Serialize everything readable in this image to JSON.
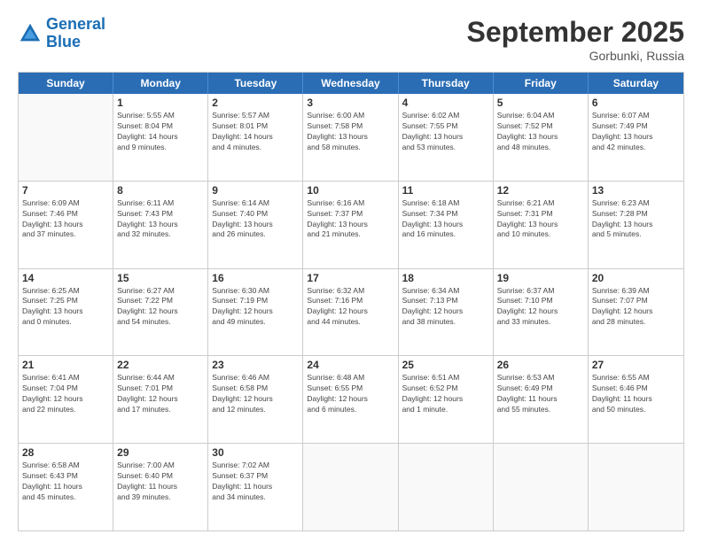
{
  "logo": {
    "line1": "General",
    "line2": "Blue"
  },
  "title": "September 2025",
  "location": "Gorbunki, Russia",
  "days_header": [
    "Sunday",
    "Monday",
    "Tuesday",
    "Wednesday",
    "Thursday",
    "Friday",
    "Saturday"
  ],
  "weeks": [
    [
      {
        "day": "",
        "info": ""
      },
      {
        "day": "1",
        "info": "Sunrise: 5:55 AM\nSunset: 8:04 PM\nDaylight: 14 hours\nand 9 minutes."
      },
      {
        "day": "2",
        "info": "Sunrise: 5:57 AM\nSunset: 8:01 PM\nDaylight: 14 hours\nand 4 minutes."
      },
      {
        "day": "3",
        "info": "Sunrise: 6:00 AM\nSunset: 7:58 PM\nDaylight: 13 hours\nand 58 minutes."
      },
      {
        "day": "4",
        "info": "Sunrise: 6:02 AM\nSunset: 7:55 PM\nDaylight: 13 hours\nand 53 minutes."
      },
      {
        "day": "5",
        "info": "Sunrise: 6:04 AM\nSunset: 7:52 PM\nDaylight: 13 hours\nand 48 minutes."
      },
      {
        "day": "6",
        "info": "Sunrise: 6:07 AM\nSunset: 7:49 PM\nDaylight: 13 hours\nand 42 minutes."
      }
    ],
    [
      {
        "day": "7",
        "info": "Sunrise: 6:09 AM\nSunset: 7:46 PM\nDaylight: 13 hours\nand 37 minutes."
      },
      {
        "day": "8",
        "info": "Sunrise: 6:11 AM\nSunset: 7:43 PM\nDaylight: 13 hours\nand 32 minutes."
      },
      {
        "day": "9",
        "info": "Sunrise: 6:14 AM\nSunset: 7:40 PM\nDaylight: 13 hours\nand 26 minutes."
      },
      {
        "day": "10",
        "info": "Sunrise: 6:16 AM\nSunset: 7:37 PM\nDaylight: 13 hours\nand 21 minutes."
      },
      {
        "day": "11",
        "info": "Sunrise: 6:18 AM\nSunset: 7:34 PM\nDaylight: 13 hours\nand 16 minutes."
      },
      {
        "day": "12",
        "info": "Sunrise: 6:21 AM\nSunset: 7:31 PM\nDaylight: 13 hours\nand 10 minutes."
      },
      {
        "day": "13",
        "info": "Sunrise: 6:23 AM\nSunset: 7:28 PM\nDaylight: 13 hours\nand 5 minutes."
      }
    ],
    [
      {
        "day": "14",
        "info": "Sunrise: 6:25 AM\nSunset: 7:25 PM\nDaylight: 13 hours\nand 0 minutes."
      },
      {
        "day": "15",
        "info": "Sunrise: 6:27 AM\nSunset: 7:22 PM\nDaylight: 12 hours\nand 54 minutes."
      },
      {
        "day": "16",
        "info": "Sunrise: 6:30 AM\nSunset: 7:19 PM\nDaylight: 12 hours\nand 49 minutes."
      },
      {
        "day": "17",
        "info": "Sunrise: 6:32 AM\nSunset: 7:16 PM\nDaylight: 12 hours\nand 44 minutes."
      },
      {
        "day": "18",
        "info": "Sunrise: 6:34 AM\nSunset: 7:13 PM\nDaylight: 12 hours\nand 38 minutes."
      },
      {
        "day": "19",
        "info": "Sunrise: 6:37 AM\nSunset: 7:10 PM\nDaylight: 12 hours\nand 33 minutes."
      },
      {
        "day": "20",
        "info": "Sunrise: 6:39 AM\nSunset: 7:07 PM\nDaylight: 12 hours\nand 28 minutes."
      }
    ],
    [
      {
        "day": "21",
        "info": "Sunrise: 6:41 AM\nSunset: 7:04 PM\nDaylight: 12 hours\nand 22 minutes."
      },
      {
        "day": "22",
        "info": "Sunrise: 6:44 AM\nSunset: 7:01 PM\nDaylight: 12 hours\nand 17 minutes."
      },
      {
        "day": "23",
        "info": "Sunrise: 6:46 AM\nSunset: 6:58 PM\nDaylight: 12 hours\nand 12 minutes."
      },
      {
        "day": "24",
        "info": "Sunrise: 6:48 AM\nSunset: 6:55 PM\nDaylight: 12 hours\nand 6 minutes."
      },
      {
        "day": "25",
        "info": "Sunrise: 6:51 AM\nSunset: 6:52 PM\nDaylight: 12 hours\nand 1 minute."
      },
      {
        "day": "26",
        "info": "Sunrise: 6:53 AM\nSunset: 6:49 PM\nDaylight: 11 hours\nand 55 minutes."
      },
      {
        "day": "27",
        "info": "Sunrise: 6:55 AM\nSunset: 6:46 PM\nDaylight: 11 hours\nand 50 minutes."
      }
    ],
    [
      {
        "day": "28",
        "info": "Sunrise: 6:58 AM\nSunset: 6:43 PM\nDaylight: 11 hours\nand 45 minutes."
      },
      {
        "day": "29",
        "info": "Sunrise: 7:00 AM\nSunset: 6:40 PM\nDaylight: 11 hours\nand 39 minutes."
      },
      {
        "day": "30",
        "info": "Sunrise: 7:02 AM\nSunset: 6:37 PM\nDaylight: 11 hours\nand 34 minutes."
      },
      {
        "day": "",
        "info": ""
      },
      {
        "day": "",
        "info": ""
      },
      {
        "day": "",
        "info": ""
      },
      {
        "day": "",
        "info": ""
      }
    ]
  ]
}
